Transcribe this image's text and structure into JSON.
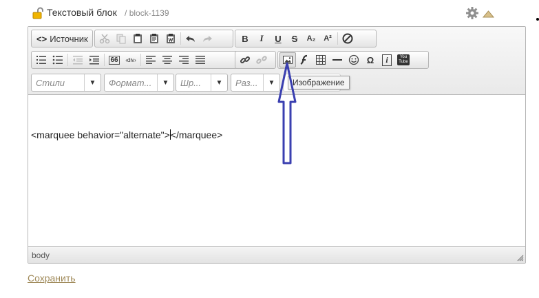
{
  "header": {
    "title": "Текстовый блок",
    "sub_separator": "/",
    "block_id": "block-1139"
  },
  "toolbar": {
    "source_label": "Источник",
    "source_glyph": "<>",
    "combos": {
      "styles": "Стили",
      "format": "Формат...",
      "font": "Шр...",
      "size": "Раз..."
    },
    "glyphs": {
      "bold": "B",
      "italic": "I",
      "underline": "U",
      "strike": "S",
      "subscript": "A₂",
      "superscript": "A²",
      "quote": "66",
      "div": "‹div›",
      "special_char": "Ω",
      "iframe": "i",
      "youtube": "You Tube"
    }
  },
  "tooltip": {
    "label": "Изображение"
  },
  "content": {
    "before_caret": "<marquee behavior=\"alternate\">",
    "after_caret": "</marquee>"
  },
  "path_bar": {
    "element": "body"
  },
  "footer": {
    "save_label": "Сохранить"
  },
  "colors": {
    "annotation_arrow": "#3a3fb0",
    "save_link": "#a08a5a",
    "lock": "#e0a800"
  }
}
